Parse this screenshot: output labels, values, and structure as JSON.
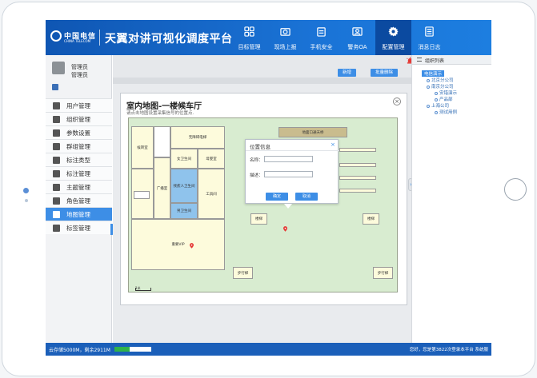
{
  "header": {
    "logo_cn": "中国电信",
    "logo_en": "CHINA TELECOM",
    "app_title": "天翼对讲可视化调度平台",
    "nav": [
      {
        "label": "目标管理",
        "icon": "grid-icon",
        "active": false
      },
      {
        "label": "现场上报",
        "icon": "camera-icon",
        "active": false
      },
      {
        "label": "手机安全",
        "icon": "clipboard-icon",
        "active": false
      },
      {
        "label": "警务OA",
        "icon": "id-card-icon",
        "active": false
      },
      {
        "label": "配置管理",
        "icon": "gear-icon",
        "active": true
      },
      {
        "label": "消息日志",
        "icon": "document-icon",
        "active": false
      }
    ]
  },
  "user": {
    "name": "管理员",
    "role": "管理员"
  },
  "sidebar": {
    "items": [
      {
        "label": "用户管理",
        "icon": "user-icon"
      },
      {
        "label": "组织管理",
        "icon": "org-icon"
      },
      {
        "label": "参数设置",
        "icon": "settings-icon"
      },
      {
        "label": "群组管理",
        "icon": "group-icon"
      },
      {
        "label": "标注类型",
        "icon": "flag-icon"
      },
      {
        "label": "标注管理",
        "icon": "tag-user-icon"
      },
      {
        "label": "主题管理",
        "icon": "folder-icon"
      },
      {
        "label": "角色管理",
        "icon": "role-icon"
      },
      {
        "label": "地图管理",
        "icon": "layers-icon",
        "active": true
      },
      {
        "label": "标签管理",
        "icon": "label-icon"
      }
    ]
  },
  "toolbar": {
    "add_label": "新增",
    "batch_delete_label": "批量删除"
  },
  "modal": {
    "title": "室内地图-一楼候车厅",
    "subtitle": "请点击地图设置采集信号的位置点.",
    "close": "×"
  },
  "map": {
    "rooms": {
      "hall_top": "地面口通天桥",
      "r1": "候转室",
      "r2": "无障碍电梯",
      "r3": "女卫生间",
      "r4": "母婴室",
      "r5": "楼梯",
      "r6": "广播室",
      "r7": "残疾人卫生间",
      "r8": "男卫生间",
      "r9": "工具间",
      "r10": "楼梯",
      "r11": "楼梯",
      "r12": "重要VIP",
      "r13": "步行梯",
      "r14": "步行梯"
    },
    "scale": "1米"
  },
  "popup": {
    "title": "位置信息",
    "close": "×",
    "name_label": "名称：",
    "name_value": "",
    "desc_label": "描述：",
    "desc_value": "",
    "confirm": "确定",
    "cancel": "取消"
  },
  "org_tree": {
    "title": "组织列表",
    "nodes": [
      {
        "label": "电信演示",
        "level": 0,
        "selected": true
      },
      {
        "label": "北京分公司",
        "level": 1
      },
      {
        "label": "南京分公司",
        "level": 1
      },
      {
        "label": "安错演示",
        "level": 2
      },
      {
        "label": "产品部",
        "level": 2
      },
      {
        "label": "上海公司",
        "level": 1
      },
      {
        "label": "测试用例",
        "level": 2
      }
    ]
  },
  "status": {
    "storage_text": "云存储5000M，剩余2911M",
    "storage_used_fraction": 0.42,
    "welcome": "您好，您是第3822次登录本平台 系统服"
  },
  "colors": {
    "header": "#1a73d6",
    "accent": "#3d8ee6",
    "status": "#1b5fb9",
    "progress": "#2fb24a"
  }
}
